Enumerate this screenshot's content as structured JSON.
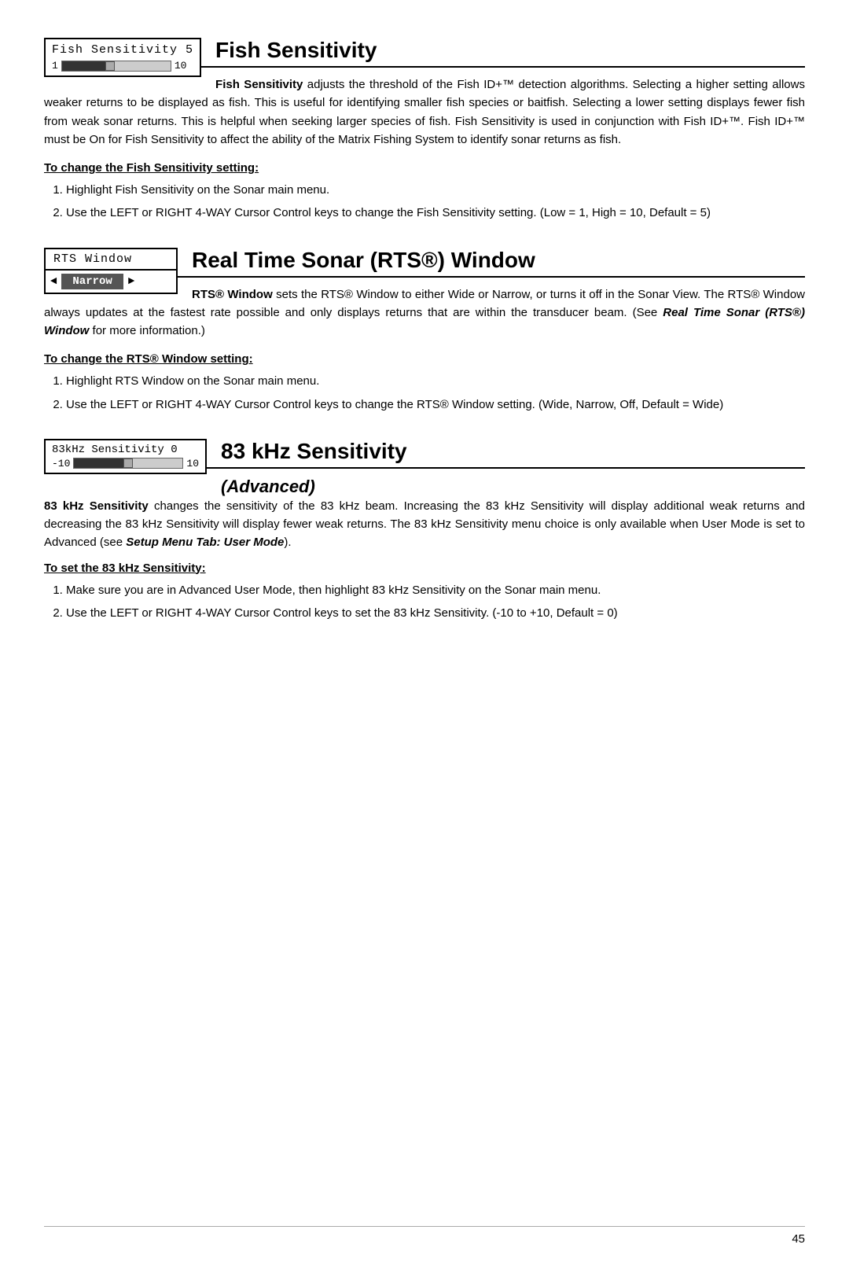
{
  "page": {
    "number": "45"
  },
  "fish_sensitivity": {
    "section_title": "Fish Sensitivity",
    "widget": {
      "title_row": "Fish Sensitivity  5",
      "slider_min": "1",
      "slider_max": "10",
      "slider_fill_pct": 45,
      "slider_thumb_pct": 45
    },
    "body": "Fish Sensitivity adjusts the threshold of the Fish ID+™ detection algorithms.  Selecting a higher setting allows weaker returns to be displayed as fish.  This is useful for identifying smaller fish species or baitfish.  Selecting a lower setting displays fewer fish from weak sonar returns.  This is helpful when seeking larger species of fish. Fish Sensitivity is used in conjunction with Fish ID+™. Fish ID+™ must be On for Fish Sensitivity to affect the ability of the  Matrix Fishing System to identify sonar returns as fish.",
    "body_bold_start": "Fish Sensitivity",
    "subheading": "To change the Fish Sensitivity setting:",
    "steps": [
      "Highlight Fish Sensitivity on the Sonar main menu.",
      "Use the LEFT or RIGHT 4-WAY Cursor Control keys to change the Fish Sensitivity setting.  (Low = 1, High = 10, Default = 5)"
    ]
  },
  "rts_window": {
    "section_title": "Real Time Sonar (RTS®) Window",
    "widget": {
      "title_row": "RTS  Window",
      "value": "Narrow"
    },
    "body_bold": "RTS® Window",
    "body": "RTS® Window sets the RTS® Window to either Wide or Narrow, or turns it off in the Sonar View. The RTS® Window always updates at the fastest rate possible and only displays returns that are within the transducer beam. (See Real Time Sonar (RTS®) Window for more information.)",
    "body_italic_bold": "Real Time Sonar (RTS®) Window",
    "subheading": "To change the RTS® Window setting:",
    "steps": [
      "Highlight RTS Window on the Sonar main menu.",
      "Use the LEFT or RIGHT 4-WAY Cursor Control keys to change the RTS® Window setting.  (Wide, Narrow, Off, Default = Wide)"
    ]
  },
  "khz_sensitivity": {
    "section_title": "83 kHz Sensitivity",
    "advanced_label": "(Advanced)",
    "widget": {
      "title_row": "83kHz Sensitivity  0",
      "slider_min": "-10",
      "slider_max": "10",
      "slider_fill_pct": 50,
      "slider_thumb_pct": 50
    },
    "body_bold": "83 kHz Sensitivity",
    "body": "83 kHz Sensitivity changes the sensitivity of the 83 kHz beam.  Increasing the 83 kHz Sensitivity will display additional weak returns and decreasing the 83 kHz Sensitivity will display fewer weak returns. The 83 kHz Sensitivity menu choice is only available when User Mode is set to Advanced (see Setup Menu Tab: User Mode).",
    "body_italic_bold": "Setup Menu Tab: User Mode",
    "subheading": "To set the 83 kHz Sensitivity:",
    "steps": [
      "Make sure you are in Advanced User Mode, then highlight 83 kHz Sensitivity on the Sonar main menu.",
      "Use the LEFT or RIGHT 4-WAY Cursor Control keys to set the 83 kHz Sensitivity. (-10 to +10, Default = 0)"
    ]
  }
}
